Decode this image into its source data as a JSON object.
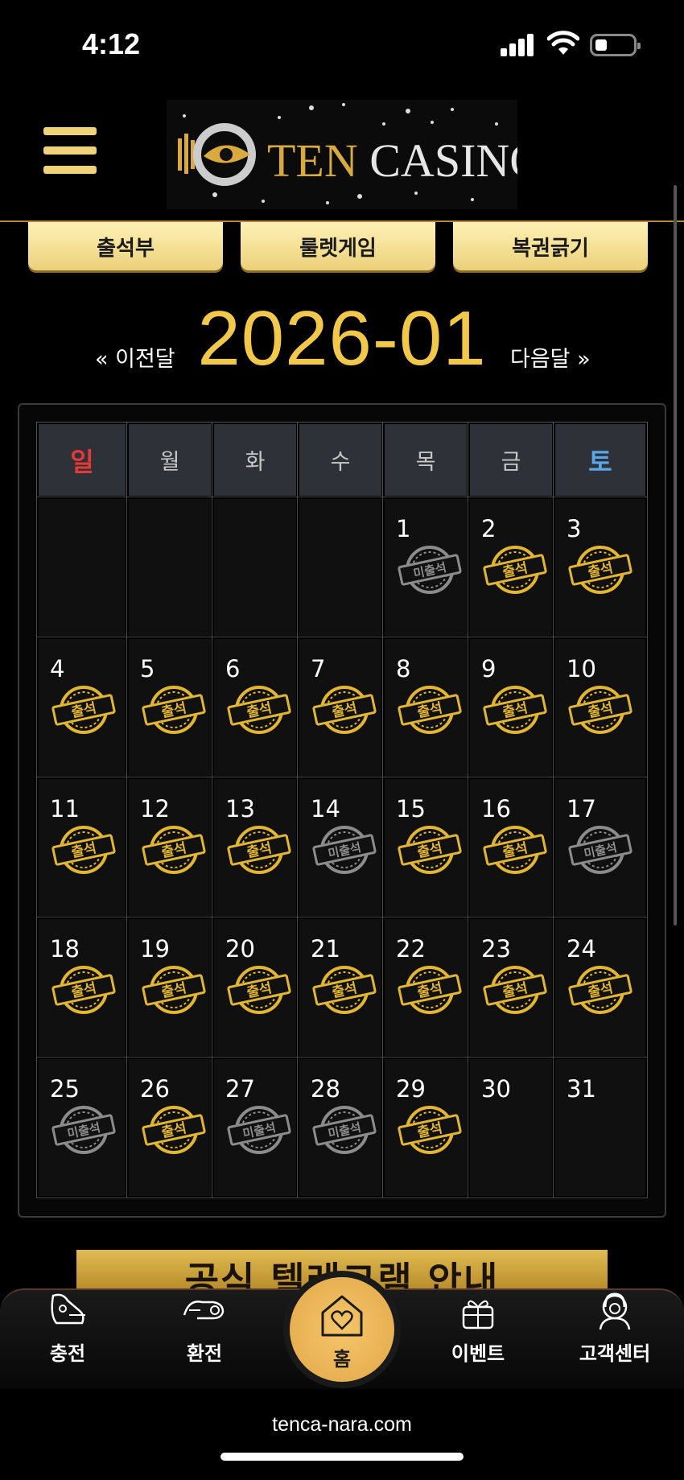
{
  "status_bar": {
    "time": "4:12"
  },
  "header": {
    "logo_ten": "TEN",
    "logo_casino": "CASINO"
  },
  "top_buttons": [
    {
      "label": "출석부"
    },
    {
      "label": "룰렛게임"
    },
    {
      "label": "복권긁기"
    }
  ],
  "month_nav": {
    "prev": "« 이전달",
    "title": "2026-01",
    "next": "다음달 »"
  },
  "calendar": {
    "weekdays": [
      "일",
      "월",
      "화",
      "수",
      "목",
      "금",
      "토"
    ],
    "stamp_labels": {
      "present": "출석",
      "absent": "미출석"
    },
    "stamp_colors": {
      "present": "#e2b632",
      "absent": "#8c8c8c"
    },
    "weeks": [
      [
        null,
        null,
        null,
        null,
        {
          "day": "1",
          "status": "absent"
        },
        {
          "day": "2",
          "status": "present"
        },
        {
          "day": "3",
          "status": "present"
        }
      ],
      [
        {
          "day": "4",
          "status": "present"
        },
        {
          "day": "5",
          "status": "present"
        },
        {
          "day": "6",
          "status": "present"
        },
        {
          "day": "7",
          "status": "present"
        },
        {
          "day": "8",
          "status": "present"
        },
        {
          "day": "9",
          "status": "present"
        },
        {
          "day": "10",
          "status": "present"
        }
      ],
      [
        {
          "day": "11",
          "status": "present"
        },
        {
          "day": "12",
          "status": "present"
        },
        {
          "day": "13",
          "status": "present"
        },
        {
          "day": "14",
          "status": "absent"
        },
        {
          "day": "15",
          "status": "present"
        },
        {
          "day": "16",
          "status": "present"
        },
        {
          "day": "17",
          "status": "absent"
        }
      ],
      [
        {
          "day": "18",
          "status": "present"
        },
        {
          "day": "19",
          "status": "present"
        },
        {
          "day": "20",
          "status": "present"
        },
        {
          "day": "21",
          "status": "present"
        },
        {
          "day": "22",
          "status": "present"
        },
        {
          "day": "23",
          "status": "present"
        },
        {
          "day": "24",
          "status": "present"
        }
      ],
      [
        {
          "day": "25",
          "status": "absent"
        },
        {
          "day": "26",
          "status": "present"
        },
        {
          "day": "27",
          "status": "absent"
        },
        {
          "day": "28",
          "status": "absent"
        },
        {
          "day": "29",
          "status": "present"
        },
        {
          "day": "30",
          "status": "none"
        },
        {
          "day": "31",
          "status": "none"
        }
      ]
    ]
  },
  "banner": {
    "text": "공식 텔레그램 안내"
  },
  "bottom_nav": {
    "items": [
      {
        "label": "충전",
        "icon": "charge-icon"
      },
      {
        "label": "환전",
        "icon": "exchange-icon"
      },
      {
        "label": "홈",
        "icon": "home-heart-icon"
      },
      {
        "label": "이벤트",
        "icon": "gift-icon"
      },
      {
        "label": "고객센터",
        "icon": "support-icon"
      }
    ]
  },
  "browser": {
    "url": "tenca-nara.com"
  },
  "colors": {
    "gold": "#f2c84b",
    "button_gold": "#ead07a",
    "sunday": "#e53935",
    "saturday": "#5aa7e8"
  }
}
